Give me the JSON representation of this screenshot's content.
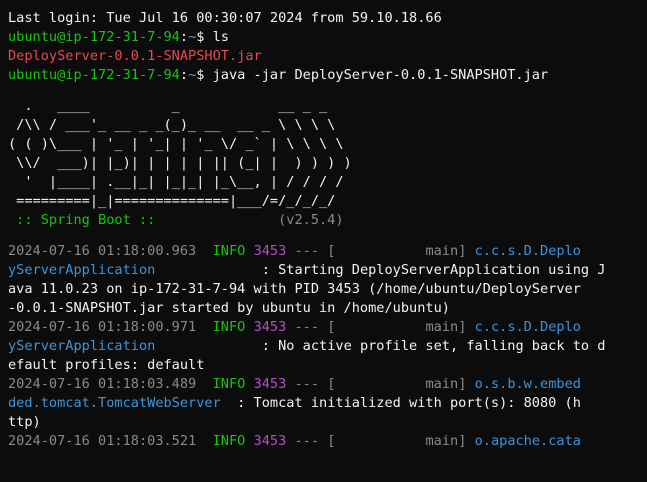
{
  "terminal": {
    "last_login": "Last login: Tue Jul 16 00:30:07 2024 from 59.10.18.66",
    "prompt_user": "ubuntu@ip-172-31-7-94",
    "prompt_sep": ":",
    "prompt_path": "~",
    "prompt_sigil": "$",
    "cmd1": " ls",
    "ls_output": "DeployServer-0.0.1-SNAPSHOT.jar",
    "cmd2": " java -jar DeployServer-0.0.1-SNAPSHOT.jar"
  },
  "banner": {
    "lines": [
      "  .   ____          _            __ _ _",
      " /\\\\ / ___'_ __ _ _(_)_ __  __ _ \\ \\ \\ \\",
      "( ( )\\___ | '_ | '_| | '_ \\/ _` | \\ \\ \\ \\",
      " \\\\/  ___)| |_)| | | | | || (_| |  ) ) ) )",
      "  '  |____| .__|_| |_|_| |_\\__, | / / / /",
      " =========|_|==============|___/=/_/_/_/"
    ],
    "spring_label": " :: Spring Boot :: ",
    "version": "(v2.5.4)"
  },
  "logs": [
    {
      "ts": "2024-07-16 01:18:00.963",
      "level": "INFO",
      "pid": "3453",
      "thread_prefix": " --- [           ",
      "thread": "main",
      "logger_a": "c.c.s.D.Deplo",
      "logger_b": "yServerApplication",
      "msg_first": ": Starting DeployServerApplication using J",
      "msg_rest": [
        "ava 11.0.23 on ip-172-31-7-94 with PID 3453 (/home/ubuntu/DeployServer",
        "-0.0.1-SNAPSHOT.jar started by ubuntu in /home/ubuntu)"
      ]
    },
    {
      "ts": "2024-07-16 01:18:00.971",
      "level": "INFO",
      "pid": "3453",
      "thread_prefix": " --- [           ",
      "thread": "main",
      "logger_a": "c.c.s.D.Deplo",
      "logger_b": "yServerApplication",
      "msg_first": ": No active profile set, falling back to d",
      "msg_rest": [
        "efault profiles: default"
      ]
    },
    {
      "ts": "2024-07-16 01:18:03.489",
      "level": "INFO",
      "pid": "3453",
      "thread_prefix": " --- [           ",
      "thread": "main",
      "logger_a": "o.s.b.w.embed",
      "logger_b": "ded.tomcat.TomcatWebServer",
      "msg_first": ": Tomcat initialized with port(s): 8080 (h",
      "msg_rest": [
        "ttp)"
      ]
    },
    {
      "ts": "2024-07-16 01:18:03.521",
      "level": "INFO",
      "pid": "3453",
      "thread_prefix": " --- [           ",
      "thread": "main",
      "logger_a": "o.apache.cata",
      "logger_b": "",
      "msg_first": "",
      "msg_rest": []
    }
  ]
}
